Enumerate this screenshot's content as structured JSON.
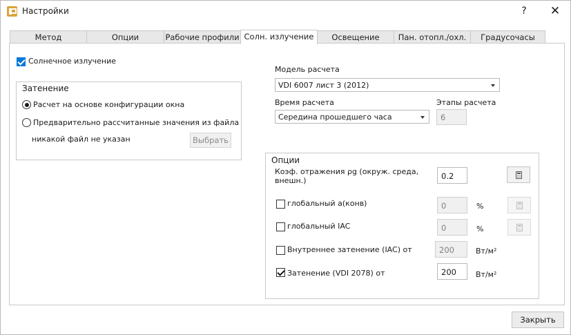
{
  "window": {
    "title": "Настройки",
    "help_label": "?",
    "close_label": "✕"
  },
  "tabs": [
    {
      "label": "Метод"
    },
    {
      "label": "Опции"
    },
    {
      "label": "Рабочие профили"
    },
    {
      "label": "Солн. излучение"
    },
    {
      "label": "Освещение"
    },
    {
      "label": "Пан. отопл./охл."
    },
    {
      "label": "Градусочасы"
    }
  ],
  "solar": {
    "enable_label": "Солнечное излучение",
    "enabled": true
  },
  "shading": {
    "title": "Затенение",
    "option_window": "Расчет на основе конфигурации окна",
    "option_file": "Предварительно рассчитанные значения из файла",
    "file_status": "никакой файл не указан",
    "select_button": "Выбрать"
  },
  "model": {
    "label": "Модель расчета",
    "value": "VDI 6007 лист 3 (2012)"
  },
  "time": {
    "label": "Время расчета",
    "value": "Середина прошедшего часа"
  },
  "steps": {
    "label": "Этапы расчета",
    "value": "6"
  },
  "options": {
    "title": "Опции",
    "reflection_label": "Коэф. отражения ρg (окруж. среда, внешн.)",
    "reflection_value": "0.2",
    "global_a_label": "глобальный a(конв)",
    "global_a_value": "0",
    "global_a_unit": "%",
    "global_iac_label": "глобальный IAC",
    "global_iac_value": "0",
    "global_iac_unit": "%",
    "inner_shading_label": "Внутреннее затенение (IAC) от",
    "inner_shading_value": "200",
    "inner_shading_unit": "Вт/м²",
    "vdi_shading_label": "Затенение (VDI 2078) от",
    "vdi_shading_value": "200",
    "vdi_shading_unit": "Вт/м²"
  },
  "footer": {
    "close_button": "Закрыть"
  }
}
